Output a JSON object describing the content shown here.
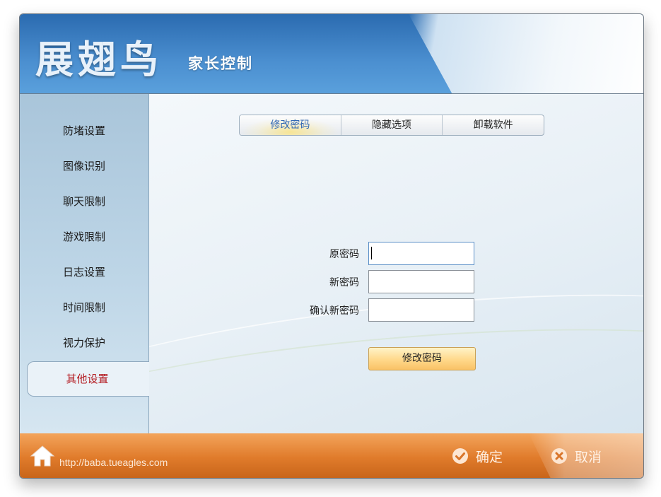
{
  "header": {
    "logo": "展翅鸟",
    "subtitle": "家长控制"
  },
  "sidebar": {
    "items": [
      {
        "label": "防堵设置"
      },
      {
        "label": "图像识别"
      },
      {
        "label": "聊天限制"
      },
      {
        "label": "游戏限制"
      },
      {
        "label": "日志设置"
      },
      {
        "label": "时间限制"
      },
      {
        "label": "视力保护"
      },
      {
        "label": "其他设置",
        "active": true
      }
    ]
  },
  "main": {
    "tabs": [
      {
        "label": "修改密码",
        "active": true
      },
      {
        "label": "隐藏选项"
      },
      {
        "label": "卸载软件"
      }
    ],
    "form": {
      "old_password_label": "原密码",
      "old_password_value": "",
      "new_password_label": "新密码",
      "new_password_value": "",
      "confirm_password_label": "确认新密码",
      "confirm_password_value": "",
      "submit_label": "修改密码"
    }
  },
  "footer": {
    "url": "http://baba.tueagles.com",
    "ok_label": "确定",
    "cancel_label": "取消",
    "home_icon": "home-icon",
    "ok_icon": "check-circle-icon",
    "cancel_icon": "x-circle-icon"
  },
  "colors": {
    "header_blue": "#2b6bb0",
    "footer_orange": "#e07b2b",
    "active_red": "#b3181e",
    "active_tab_blue": "#2f66b4"
  }
}
